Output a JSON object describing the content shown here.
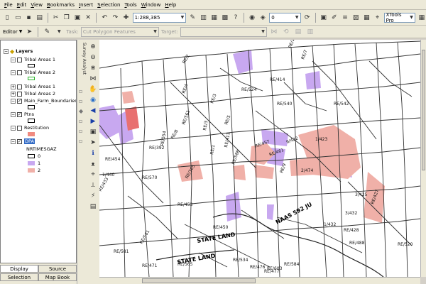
{
  "menu": [
    "File",
    "Edit",
    "View",
    "Bookmarks",
    "Insert",
    "Selection",
    "Tools",
    "Window",
    "Help"
  ],
  "toolbar": {
    "scale": "1:288,385",
    "zero_combo": "0",
    "xtools": "XTools Pro"
  },
  "editor_bar": {
    "editor_label": "Editor",
    "task_label": "Task:",
    "task_value": "Cut Polygon Features",
    "target_label": "Target:"
  },
  "toc": {
    "root": "Layers",
    "layers": [
      {
        "name": "Tribal Areas 1",
        "checked": false
      },
      {
        "name": "Tribal Areas 2",
        "checked": false
      },
      {
        "name": "Tribal Areas 1",
        "checked": false
      },
      {
        "name": "Tribal Areas 2",
        "checked": false
      },
      {
        "name": "Main_Farm_Boundaries",
        "checked": true
      },
      {
        "name": "Ptns",
        "checked": true
      },
      {
        "name": "Restitution",
        "checked": false
      },
      {
        "name": "DPA",
        "checked": true
      }
    ],
    "dpa_field": "NRTIMESGAZ",
    "dpa_classes": [
      {
        "label": "0",
        "color": "#ffffff"
      },
      {
        "label": "1",
        "color": "#c8a8f0"
      },
      {
        "label": "2",
        "color": "#f0b0a8"
      }
    ],
    "tabs": [
      "Display",
      "Source",
      "Selection",
      "Map Book"
    ]
  },
  "vertical_toolbar_title": "Survey Analyst",
  "map": {
    "parcel_labels": [
      "RE/162",
      "RE/2",
      "RE/414",
      "RE/524",
      "RE/4",
      "RE/3",
      "RE/542",
      "RE/540",
      "RE/561",
      "RE/8",
      "RE/392",
      "RE/454",
      "RE/570",
      "RE/365",
      "RE/586",
      "RE/433",
      "RE/554",
      "RE/3",
      "RE/411",
      "RE/1",
      "RE/9",
      "RE/453",
      "RE/450",
      "RE/581",
      "RE/561",
      "RE/565",
      "RE/534",
      "RE/584",
      "RE/603",
      "RE/520",
      "RE/427",
      "RE/428",
      "RE/488",
      "RE/476",
      "RE/477",
      "RE/471",
      "RE/5",
      "RE/7",
      "1/423",
      "3/425",
      "3/432",
      "1/432",
      "6/422",
      "2/474",
      "1/440",
      "RE/457",
      "RE/461"
    ],
    "place_labels": [
      "STATE LAND",
      "STATE LAND",
      "NAAS 592 JU"
    ]
  },
  "colors": {
    "purple": "#c8a8f0",
    "pink": "#f0b0a8"
  }
}
